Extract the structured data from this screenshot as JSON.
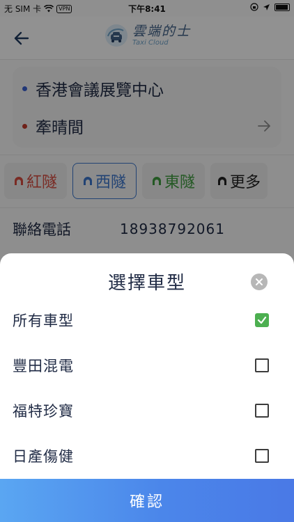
{
  "status_bar": {
    "carrier": "无 SIM 卡",
    "vpn": "VPN",
    "time": "下午8:41"
  },
  "header": {
    "logo_title": "雲端的士",
    "logo_subtitle": "Taxi Cloud"
  },
  "route": {
    "from": "香港會議展覽中心",
    "to": "牽晴間",
    "from_dot_color": "#3a5fcd",
    "to_dot_color": "#c0392b"
  },
  "tunnels": [
    {
      "label": "紅隧",
      "color": "#d24b3f",
      "selected": false
    },
    {
      "label": "西隧",
      "color": "#3b74c9",
      "selected": true
    },
    {
      "label": "東隧",
      "color": "#3f9a3f",
      "selected": false
    },
    {
      "label": "更多",
      "color": "#222222",
      "selected": false
    }
  ],
  "contact": {
    "label": "聯絡電話",
    "value": "18938792061"
  },
  "sheet": {
    "title": "選擇車型",
    "options": [
      {
        "label": "所有車型",
        "checked": true
      },
      {
        "label": "豐田混電",
        "checked": false
      },
      {
        "label": "福特珍寶",
        "checked": false
      },
      {
        "label": "日產傷健",
        "checked": false
      }
    ],
    "confirm_label": "確認",
    "accent": "#4caf50"
  }
}
